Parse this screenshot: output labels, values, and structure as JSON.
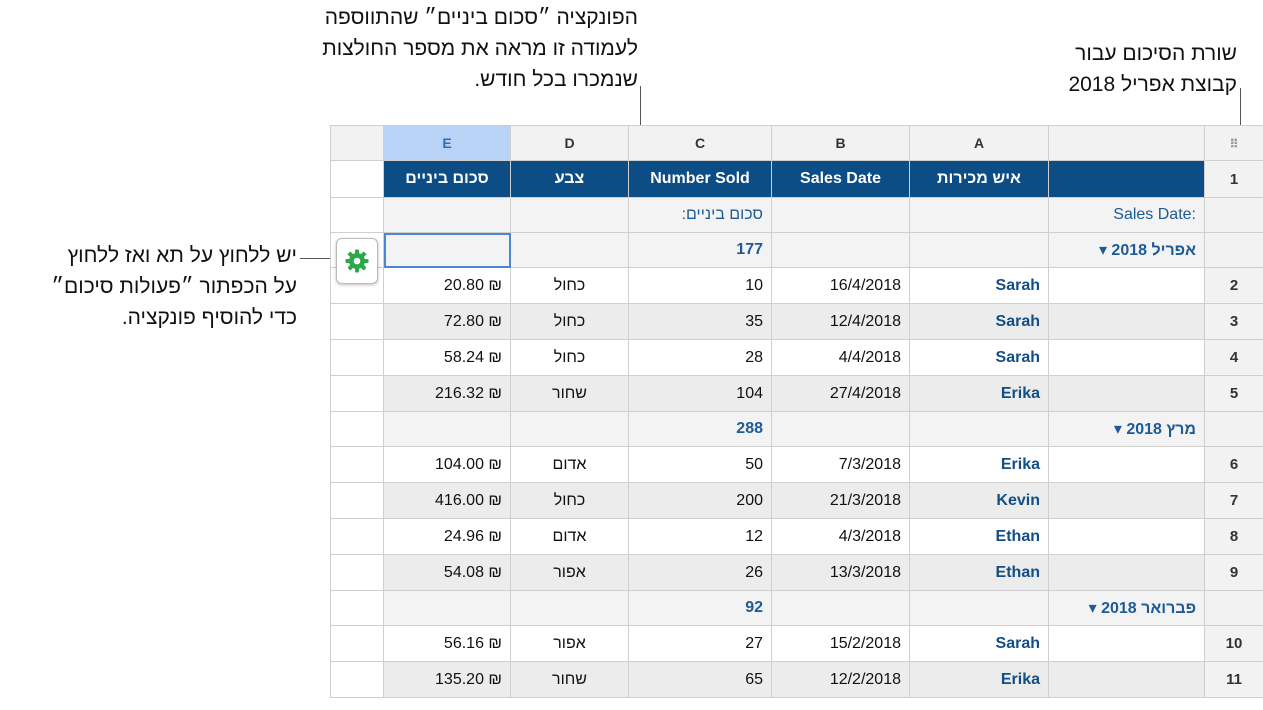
{
  "callouts": {
    "function_line1": "הפונקציה ״סכום ביניים״ שהתווספה",
    "function_line2": "לעמודה זו מראה את מספר החולצות",
    "function_line3": "שנמכרו בכל חודש.",
    "summary_line1": "שורת הסיכום עבור",
    "summary_line2": "קבוצת אפריל 2018",
    "tap_line1": "יש ללחוץ על תא ואז ללחוץ",
    "tap_line2": "על הכפתור ״פעולות סיכום״",
    "tap_line3": "כדי להוסיף פונקציה."
  },
  "columns": {
    "E": "E",
    "D": "D",
    "C": "C",
    "B": "B",
    "A": "A"
  },
  "header": {
    "rownum": "1",
    "col_e": "סכום ביניים",
    "col_d": "צבע",
    "col_c": "Number Sold",
    "col_b": "Sales Date",
    "col_a": "איש מכירות"
  },
  "first_group": {
    "top_label": "Sales Date:",
    "subtotal_label": "סכום ביניים:",
    "name": "אפריל 2018 ▾",
    "total": "177"
  },
  "groups": {
    "march": {
      "name": "מרץ 2018 ▾",
      "total": "288"
    },
    "february": {
      "name": "פברואר 2018 ▾",
      "total": "92"
    }
  },
  "rows": [
    {
      "num": "2",
      "a": "Sarah",
      "b": "16/4/2018",
      "c": "10",
      "d": "כחול",
      "e": "20.80 ₪"
    },
    {
      "num": "3",
      "a": "Sarah",
      "b": "12/4/2018",
      "c": "35",
      "d": "כחול",
      "e": "72.80 ₪"
    },
    {
      "num": "4",
      "a": "Sarah",
      "b": "4/4/2018",
      "c": "28",
      "d": "כחול",
      "e": "58.24 ₪"
    },
    {
      "num": "5",
      "a": "Erika",
      "b": "27/4/2018",
      "c": "104",
      "d": "שחור",
      "e": "216.32 ₪"
    },
    {
      "num": "6",
      "a": "Erika",
      "b": "7/3/2018",
      "c": "50",
      "d": "אדום",
      "e": "104.00 ₪"
    },
    {
      "num": "7",
      "a": "Kevin",
      "b": "21/3/2018",
      "c": "200",
      "d": "כחול",
      "e": "416.00 ₪"
    },
    {
      "num": "8",
      "a": "Ethan",
      "b": "4/3/2018",
      "c": "12",
      "d": "אדום",
      "e": "24.96 ₪"
    },
    {
      "num": "9",
      "a": "Ethan",
      "b": "13/3/2018",
      "c": "26",
      "d": "אפור",
      "e": "54.08 ₪"
    },
    {
      "num": "10",
      "a": "Sarah",
      "b": "15/2/2018",
      "c": "27",
      "d": "אפור",
      "e": "56.16 ₪"
    },
    {
      "num": "11",
      "a": "Erika",
      "b": "12/2/2018",
      "c": "65",
      "d": "שחור",
      "e": "135.20 ₪"
    }
  ],
  "colors": {
    "header_bg": "#0d4d86",
    "selected_col": "#b9d3f7",
    "gear": "#2aa84a",
    "link_text": "#1e5a96"
  },
  "icons": {
    "gear": "gear-icon",
    "table_handle": "grid-handle-icon"
  }
}
